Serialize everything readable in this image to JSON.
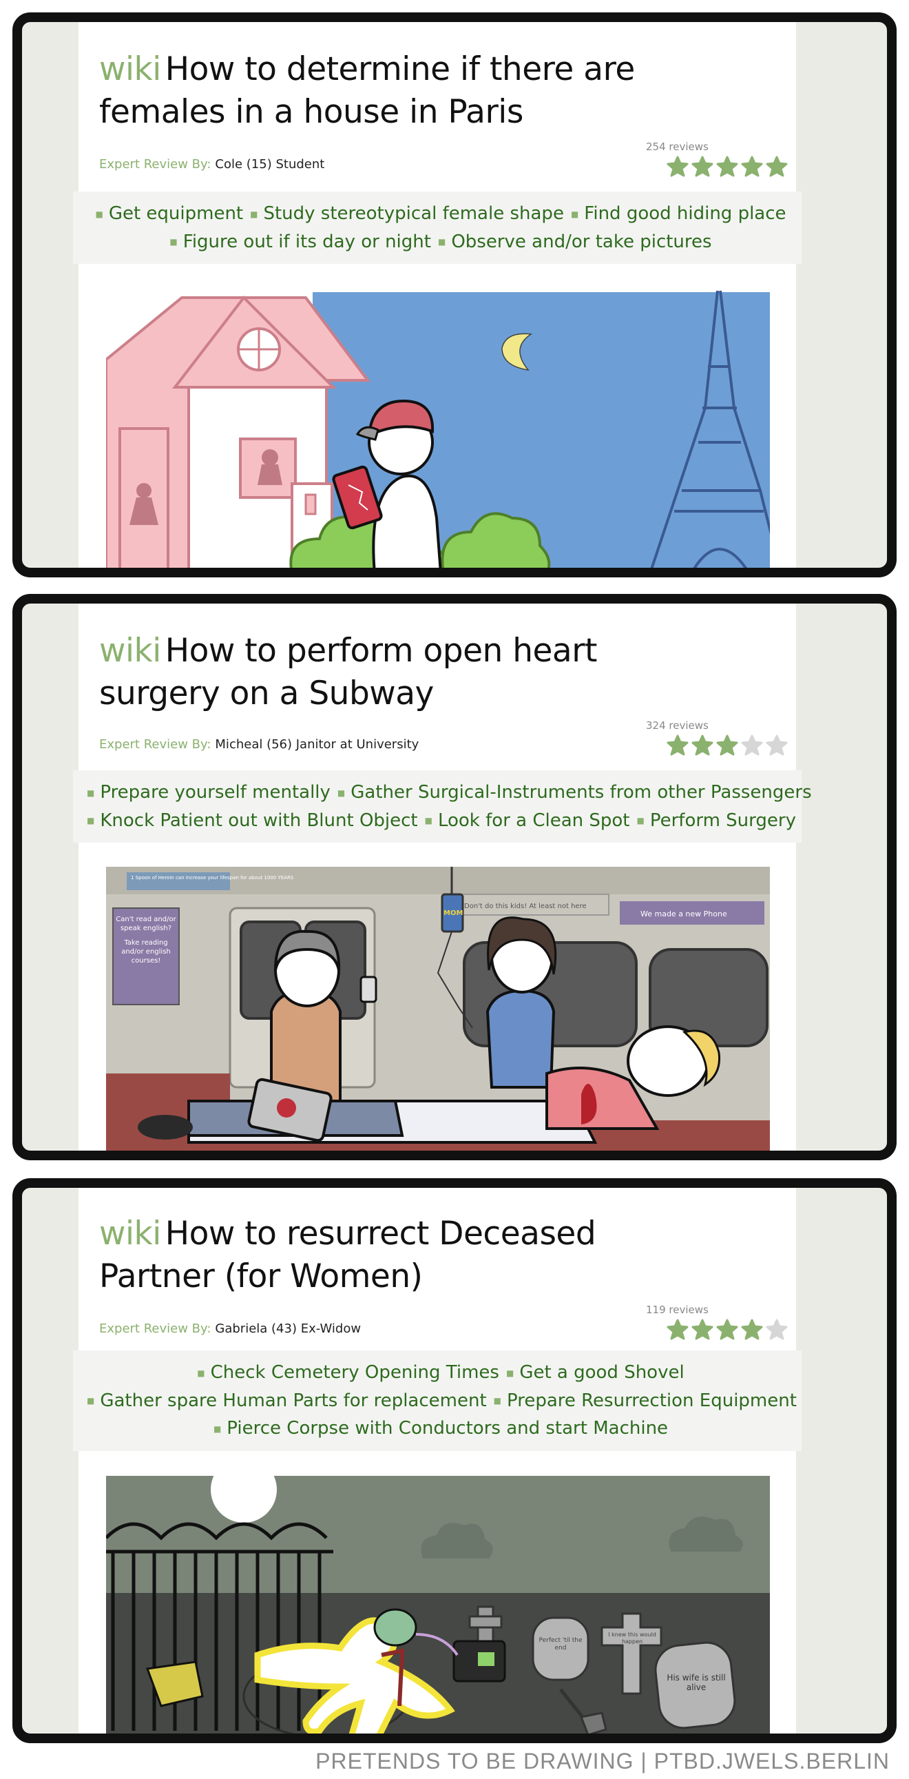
{
  "panels": [
    {
      "wiki": "wiki",
      "title_line1": "How to determine if there are",
      "title_line2": "females in a house in Paris",
      "expert_label": "Expert Review By:",
      "expert_name": "Cole (15) Student",
      "reviews": "254 reviews",
      "rating": 5,
      "step_lines": [
        [
          "Get equipment",
          "Study stereotypical female shape",
          "Find good hiding place"
        ],
        [
          "Figure out if its day or night",
          "Observe and/or take pictures"
        ]
      ]
    },
    {
      "wiki": "wiki",
      "title_line1": "How to perform open heart",
      "title_line2": "surgery on a Subway",
      "expert_label": "Expert Review By:",
      "expert_name": "Micheal (56) Janitor at University",
      "reviews": "324 reviews",
      "rating": 3,
      "step_lines": [
        [
          "Prepare yourself mentally",
          "Gather Surgical-Instruments from other Passengers"
        ],
        [
          "Knock Patient out with Blunt Object",
          "Look for a Clean Spot",
          "Perform Surgery"
        ]
      ],
      "signs": {
        "sign1": "1 Spoon of Heroin can increase your lifespan for about 1000 YEARS",
        "sign2a": "Can't read and/or speak english?",
        "sign2b": "Take reading and/or english courses!",
        "sign3": "Don't do this kids! At least not here",
        "sign4": "We made a new Phone",
        "can": "MOM"
      }
    },
    {
      "wiki": "wiki",
      "title_line1": "How to resurrect Deceased",
      "title_line2": "Partner (for Women)",
      "expert_label": "Expert Review By:",
      "expert_name": "Gabriela (43) Ex-Widow",
      "reviews": "119 reviews",
      "rating": 4,
      "step_lines": [
        [
          "Check Cemetery Opening Times",
          "Get a good Shovel"
        ],
        [
          "Gather spare Human Parts for replacement",
          "Prepare Resurrection Equipment"
        ],
        [
          "Pierce Corpse with Conductors and start Machine"
        ]
      ],
      "graves": {
        "g1": "Perfect 'til the end",
        "g2": "I knew this would happen",
        "g3": "His wife is still alive"
      }
    }
  ],
  "footer": "PRETENDS TO BE DRAWING | PTBD.JWELS.BERLIN",
  "colors": {
    "wiki_green": "#8bb16e",
    "step_green": "#2e6a1e",
    "star_on": "#8bb16e",
    "star_off": "#d6d6d6"
  }
}
